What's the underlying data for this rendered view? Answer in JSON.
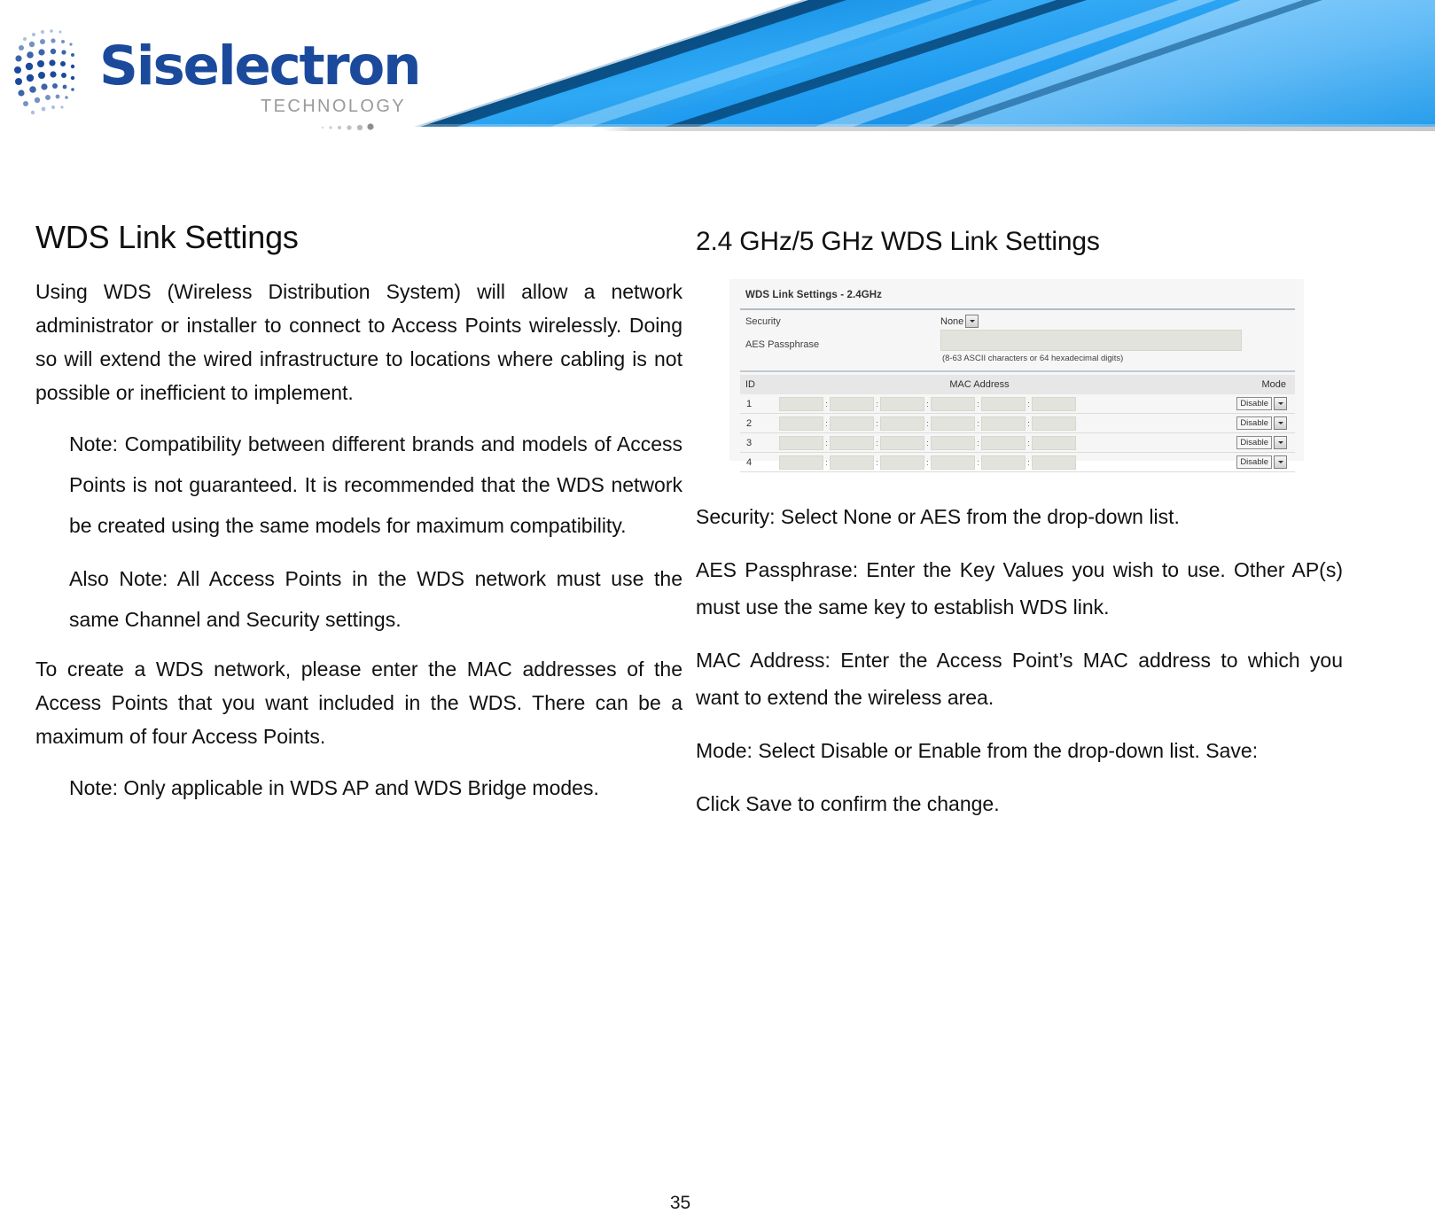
{
  "header": {
    "logo_name": "Siselectron",
    "logo_tagline": "TECHNOLOGY",
    "logo_icon": "globe-dots-icon",
    "brand_blue": "#1b4a9c",
    "ribbon_blue": "#1b9cf0"
  },
  "left_column": {
    "title": "WDS Link Settings",
    "paragraphs": [
      {
        "style": "body",
        "text": "Using WDS (Wireless Distribution System) will allow a network administrator or installer to connect to Access Points wirelessly. Doing so will extend the wired infrastructure to locations where cabling is not possible or inefficient to implement."
      },
      {
        "style": "note",
        "text": "Note: Compatibility between different brands and models of Access Points is not guaranteed. It is recommended that the WDS network be created using the same models for maximum compatibility."
      },
      {
        "style": "note",
        "text": "Also Note: All Access Points in the WDS network must use the same Channel and Security settings."
      },
      {
        "style": "body",
        "text": "To create a WDS network, please enter the MAC addresses of the Access Points that you want included in the WDS. There can be a maximum of four Access Points."
      },
      {
        "style": "note-flat",
        "text": "Note: Only applicable in WDS AP and WDS Bridge modes."
      }
    ]
  },
  "right_column": {
    "title": "2.4  GHz/5  GHz WDS Link Settings",
    "screenshot": {
      "panel_title": "WDS Link Settings - 2.4GHz",
      "security_label": "Security",
      "security_value": "None",
      "aes_label": "AES Passphrase",
      "aes_value": "",
      "aes_hint": "(8-63 ASCII characters or 64 hexadecimal digits)",
      "table": {
        "headers": [
          "ID",
          "MAC Address",
          "Mode"
        ],
        "rows": [
          {
            "id": "1",
            "mac": [
              "",
              "",
              "",
              "",
              "",
              ""
            ],
            "mode": "Disable"
          },
          {
            "id": "2",
            "mac": [
              "",
              "",
              "",
              "",
              "",
              ""
            ],
            "mode": "Disable"
          },
          {
            "id": "3",
            "mac": [
              "",
              "",
              "",
              "",
              "",
              ""
            ],
            "mode": "Disable"
          },
          {
            "id": "4",
            "mac": [
              "",
              "",
              "",
              "",
              "",
              ""
            ],
            "mode": "Disable"
          }
        ]
      }
    },
    "paragraphs": [
      {
        "style": "flat",
        "text": "Security: Select  None  or AES from  the  drop-down  list."
      },
      {
        "style": "justify",
        "text": "AES Passphrase:  Enter  the  Key  Values  you  wish  to  use. Other AP(s) must  use  the  same  key to establish WDS link."
      },
      {
        "style": "justify",
        "text": "MAC  Address:  Enter  the  Access  Point’s  MAC  address to which you want  to  extend the  wireless area."
      },
      {
        "style": "flat",
        "text": "Mode: Select  Disable or Enable from  the  drop-down  list. Save:"
      },
      {
        "style": "flat",
        "text": "Click Save  to  confirm  the  change."
      }
    ]
  },
  "footer": {
    "page_number": "35"
  }
}
